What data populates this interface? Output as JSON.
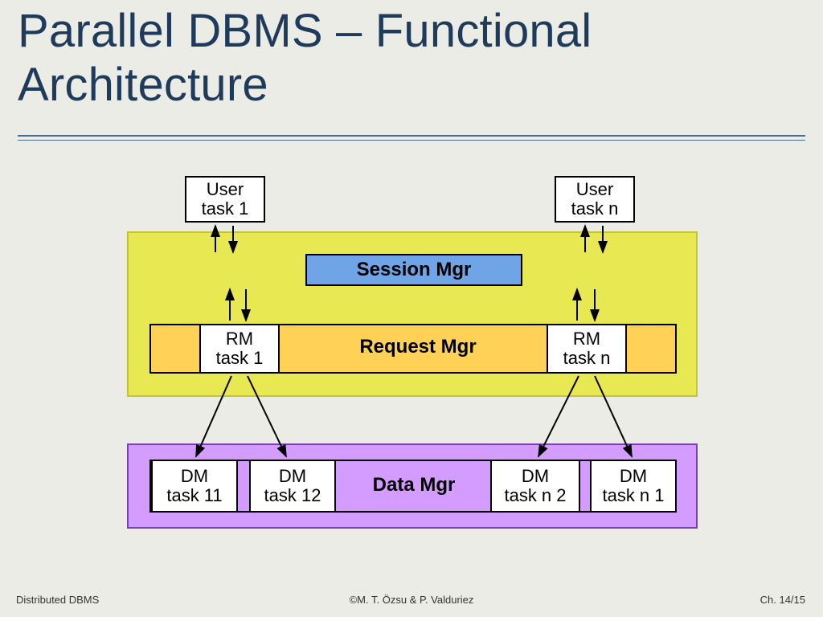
{
  "title_line1": "Parallel DBMS – Functional",
  "title_line2": "Architecture",
  "boxes": {
    "user1_l1": "User",
    "user1_l2": "task 1",
    "usern_l1": "User",
    "usern_l2": "task n",
    "rm1_l1": "RM",
    "rm1_l2": "task 1",
    "rmn_l1": "RM",
    "rmn_l2": "task n",
    "dm11_l1": "DM",
    "dm11_l2": "task 11",
    "dm12_l1": "DM",
    "dm12_l2": "task 12",
    "dmn2_l1": "DM",
    "dmn2_l2": "task n 2",
    "dmn1_l1": "DM",
    "dmn1_l2": "task n 1"
  },
  "strips": {
    "session": "Session Mgr",
    "request": "Request Mgr",
    "data": "Data Mgr"
  },
  "footer": {
    "left": "Distributed DBMS",
    "center": "©M. T. Özsu & P. Valduriez",
    "right": "Ch. 14/15"
  },
  "chart_data": {
    "type": "diagram",
    "title": "Parallel DBMS – Functional Architecture",
    "nodes": [
      {
        "id": "user1",
        "label": "User task 1",
        "layer": "users"
      },
      {
        "id": "usern",
        "label": "User task n",
        "layer": "users"
      },
      {
        "id": "session",
        "label": "Session Mgr",
        "layer": "session"
      },
      {
        "id": "rm1",
        "label": "RM task 1",
        "layer": "request"
      },
      {
        "id": "request",
        "label": "Request Mgr",
        "layer": "request"
      },
      {
        "id": "rmn",
        "label": "RM task n",
        "layer": "request"
      },
      {
        "id": "dm11",
        "label": "DM task 11",
        "layer": "data"
      },
      {
        "id": "dm12",
        "label": "DM task 12",
        "layer": "data"
      },
      {
        "id": "data",
        "label": "Data Mgr",
        "layer": "data"
      },
      {
        "id": "dmn2",
        "label": "DM task n 2",
        "layer": "data"
      },
      {
        "id": "dmn1",
        "label": "DM task n 1",
        "layer": "data"
      }
    ],
    "edges": [
      {
        "from": "user1",
        "to": "session",
        "bidirectional": true
      },
      {
        "from": "usern",
        "to": "session",
        "bidirectional": true
      },
      {
        "from": "session",
        "to": "rm1",
        "bidirectional": true
      },
      {
        "from": "session",
        "to": "rmn",
        "bidirectional": true
      },
      {
        "from": "rm1",
        "to": "dm11"
      },
      {
        "from": "rm1",
        "to": "dm12"
      },
      {
        "from": "rmn",
        "to": "dmn2"
      },
      {
        "from": "rmn",
        "to": "dmn1"
      }
    ],
    "layers_bg": {
      "upper_panel_color": "#e8e853",
      "lower_panel_color": "#d49cff",
      "session_color": "#6fa4e6",
      "request_color": "#ffd257",
      "data_color": "#d49cff"
    }
  }
}
